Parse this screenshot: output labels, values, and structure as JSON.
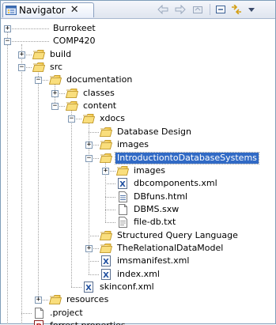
{
  "view": {
    "title": "Navigator",
    "close_glyph": "✕"
  },
  "toolbar": {
    "buttons": [
      "back-icon",
      "forward-icon",
      "up-icon",
      "collapse-all-icon",
      "link-editor-icon",
      "view-menu-icon"
    ]
  },
  "tree": [
    {
      "label": "Burrokeet",
      "icon": "project-icon",
      "expanded": false
    },
    {
      "label": "COMP420",
      "icon": "project-icon",
      "expanded": true
    },
    {
      "label": "build",
      "icon": "folder-icon",
      "expanded": false
    },
    {
      "label": "src",
      "icon": "folder-icon",
      "expanded": true
    },
    {
      "label": "documentation",
      "icon": "folder-icon",
      "expanded": true
    },
    {
      "label": "classes",
      "icon": "folder-icon",
      "expanded": false
    },
    {
      "label": "content",
      "icon": "folder-icon",
      "expanded": true
    },
    {
      "label": "xdocs",
      "icon": "folder-icon",
      "expanded": true
    },
    {
      "label": "Database Design",
      "icon": "folder-icon"
    },
    {
      "label": "images",
      "icon": "folder-icon",
      "expanded": false
    },
    {
      "label": "IntroductiontoDatabaseSystems",
      "icon": "folder-icon",
      "expanded": true,
      "selected": true
    },
    {
      "label": "images",
      "icon": "folder-icon",
      "expanded": false
    },
    {
      "label": "dbcomponents.xml",
      "icon": "xml-file-icon"
    },
    {
      "label": "DBfuns.html",
      "icon": "html-file-icon"
    },
    {
      "label": "DBMS.sxw",
      "icon": "file-icon"
    },
    {
      "label": "file-db.txt",
      "icon": "text-file-icon"
    },
    {
      "label": "Structured Query Language",
      "icon": "folder-icon"
    },
    {
      "label": "TheRelationalDataModel",
      "icon": "folder-icon",
      "expanded": false
    },
    {
      "label": "imsmanifest.xml",
      "icon": "xml-file-icon"
    },
    {
      "label": "index.xml",
      "icon": "xml-file-icon"
    },
    {
      "label": "skinconf.xml",
      "icon": "xml-file-icon"
    },
    {
      "label": "resources",
      "icon": "folder-icon",
      "expanded": false
    },
    {
      "label": ".project",
      "icon": "file-icon"
    },
    {
      "label": "forrest.properties",
      "icon": "properties-file-icon"
    }
  ],
  "colors": {
    "selection": "#316ac5",
    "folder": "#f3c849",
    "xml_badge": "#1f4fa0",
    "properties_badge": "#c0282a"
  }
}
